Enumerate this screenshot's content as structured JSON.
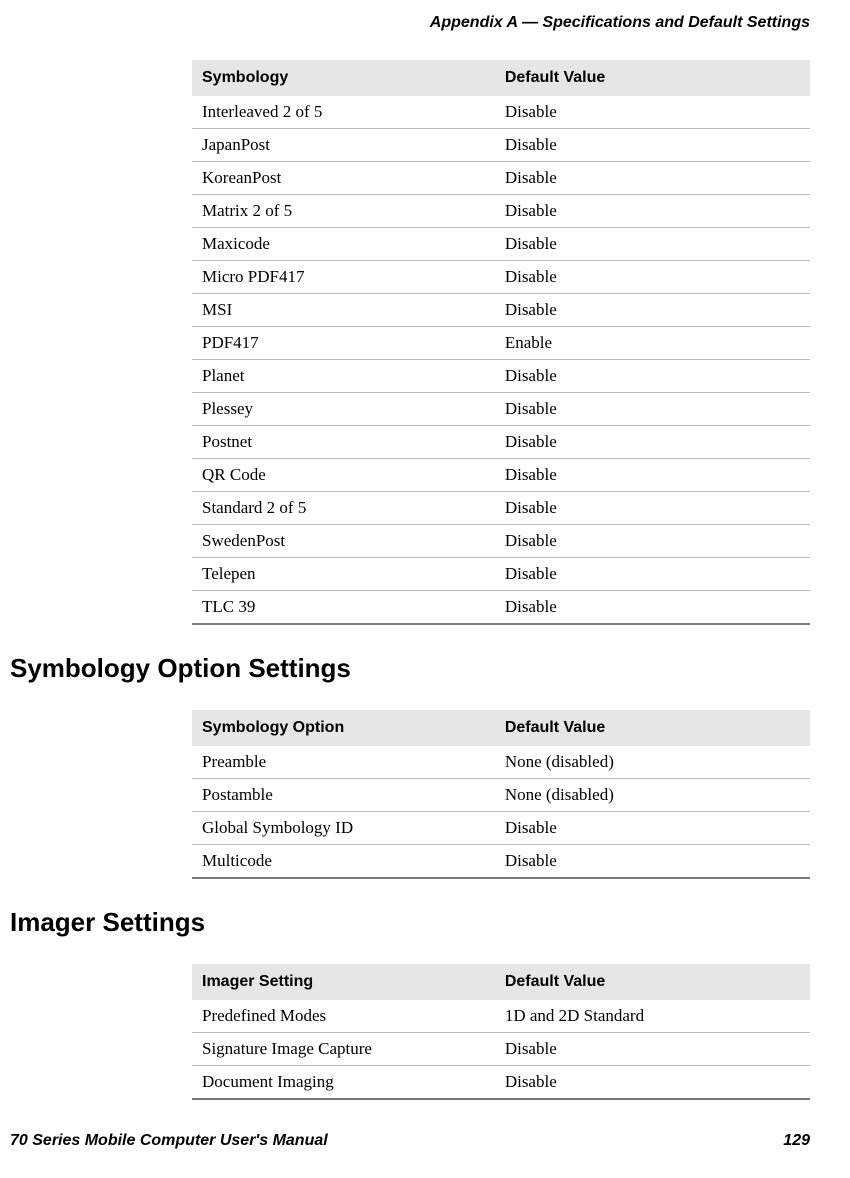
{
  "header": {
    "title": "Appendix A — Specifications and Default Settings"
  },
  "table1": {
    "headers": {
      "col1": "Symbology",
      "col2": "Default Value"
    },
    "rows": [
      {
        "c1": "Interleaved 2 of 5",
        "c2": "Disable"
      },
      {
        "c1": "JapanPost",
        "c2": "Disable"
      },
      {
        "c1": "KoreanPost",
        "c2": "Disable"
      },
      {
        "c1": "Matrix 2 of 5",
        "c2": "Disable"
      },
      {
        "c1": "Maxicode",
        "c2": "Disable"
      },
      {
        "c1": "Micro PDF417",
        "c2": "Disable"
      },
      {
        "c1": "MSI",
        "c2": "Disable"
      },
      {
        "c1": "PDF417",
        "c2": "Enable"
      },
      {
        "c1": "Planet",
        "c2": "Disable"
      },
      {
        "c1": "Plessey",
        "c2": "Disable"
      },
      {
        "c1": "Postnet",
        "c2": "Disable"
      },
      {
        "c1": "QR Code",
        "c2": "Disable"
      },
      {
        "c1": "Standard 2 of 5",
        "c2": "Disable"
      },
      {
        "c1": "SwedenPost",
        "c2": "Disable"
      },
      {
        "c1": "Telepen",
        "c2": "Disable"
      },
      {
        "c1": "TLC 39",
        "c2": "Disable"
      }
    ]
  },
  "section2": {
    "heading": "Symbology Option Settings"
  },
  "table2": {
    "headers": {
      "col1": "Symbology Option",
      "col2": "Default Value"
    },
    "rows": [
      {
        "c1": "Preamble",
        "c2": "None (disabled)"
      },
      {
        "c1": "Postamble",
        "c2": "None (disabled)"
      },
      {
        "c1": "Global Symbology ID",
        "c2": "Disable"
      },
      {
        "c1": "Multicode",
        "c2": "Disable"
      }
    ]
  },
  "section3": {
    "heading": "Imager Settings"
  },
  "table3": {
    "headers": {
      "col1": "Imager Setting",
      "col2": "Default Value"
    },
    "rows": [
      {
        "c1": "Predefined Modes",
        "c2": "1D and 2D Standard"
      },
      {
        "c1": "Signature Image Capture",
        "c2": "Disable"
      },
      {
        "c1": "Document Imaging",
        "c2": "Disable"
      }
    ]
  },
  "footer": {
    "manual": "70 Series Mobile Computer User's Manual",
    "page": "129"
  }
}
